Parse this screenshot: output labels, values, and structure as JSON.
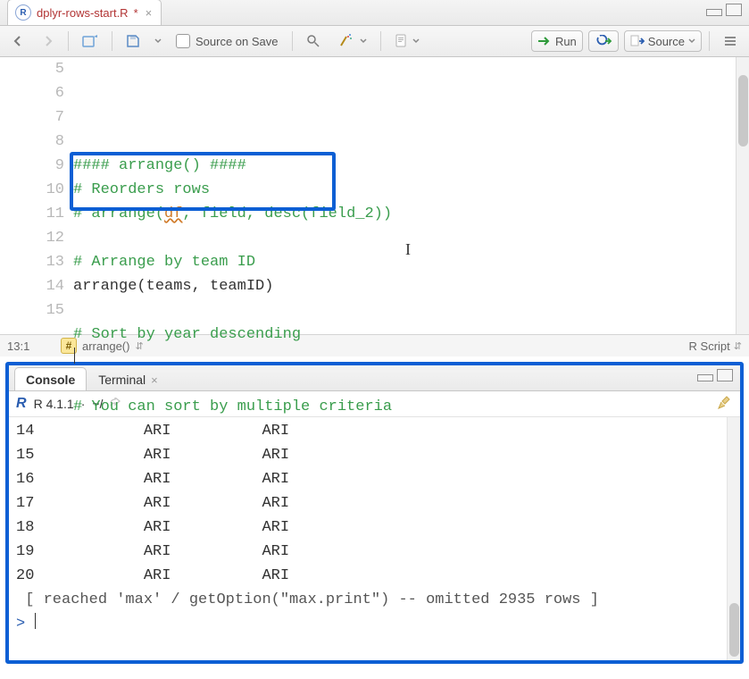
{
  "tab": {
    "icon": "R",
    "filename": "dplyr-rows-start.R",
    "modified": "*"
  },
  "toolbar": {
    "sourceOnSave": "Source on Save",
    "run": "Run",
    "source": "Source"
  },
  "editor": {
    "lines": [
      {
        "n": 5,
        "kind": "cmt",
        "text": "#### arrange() ####"
      },
      {
        "n": 6,
        "kind": "cmt",
        "text": "# Reorders rows"
      },
      {
        "n": 7,
        "kind": "arg",
        "before": "# arrange(",
        "sq": "df",
        "after": ", field, desc(field_2))"
      },
      {
        "n": 8,
        "kind": "blank",
        "text": ""
      },
      {
        "n": 9,
        "kind": "cmt",
        "text": "# Arrange by team ID"
      },
      {
        "n": 10,
        "kind": "code",
        "text": "arrange(teams, teamID)"
      },
      {
        "n": 11,
        "kind": "blank",
        "text": ""
      },
      {
        "n": 12,
        "kind": "cmt",
        "text": "# Sort by year descending"
      },
      {
        "n": 13,
        "kind": "cursor",
        "text": ""
      },
      {
        "n": 14,
        "kind": "blank",
        "text": ""
      },
      {
        "n": 15,
        "kind": "cmt",
        "text": "# You can sort by multiple criteria"
      }
    ]
  },
  "status": {
    "pos": "13:1",
    "section": "arrange()",
    "lang": "R Script"
  },
  "consoleTabs": {
    "console": "Console",
    "terminal": "Terminal"
  },
  "consoleInfo": {
    "version": "R 4.1.1",
    "path": "~/"
  },
  "consoleLines": [
    "14            ARI          ARI",
    "15            ARI          ARI",
    "16            ARI          ARI",
    "17            ARI          ARI",
    "18            ARI          ARI",
    "19            ARI          ARI",
    "20            ARI          ARI"
  ],
  "consoleTail": " [ reached 'max' / getOption(\"max.print\") -- omitted 2935 rows ]",
  "consolePrompt": ">"
}
